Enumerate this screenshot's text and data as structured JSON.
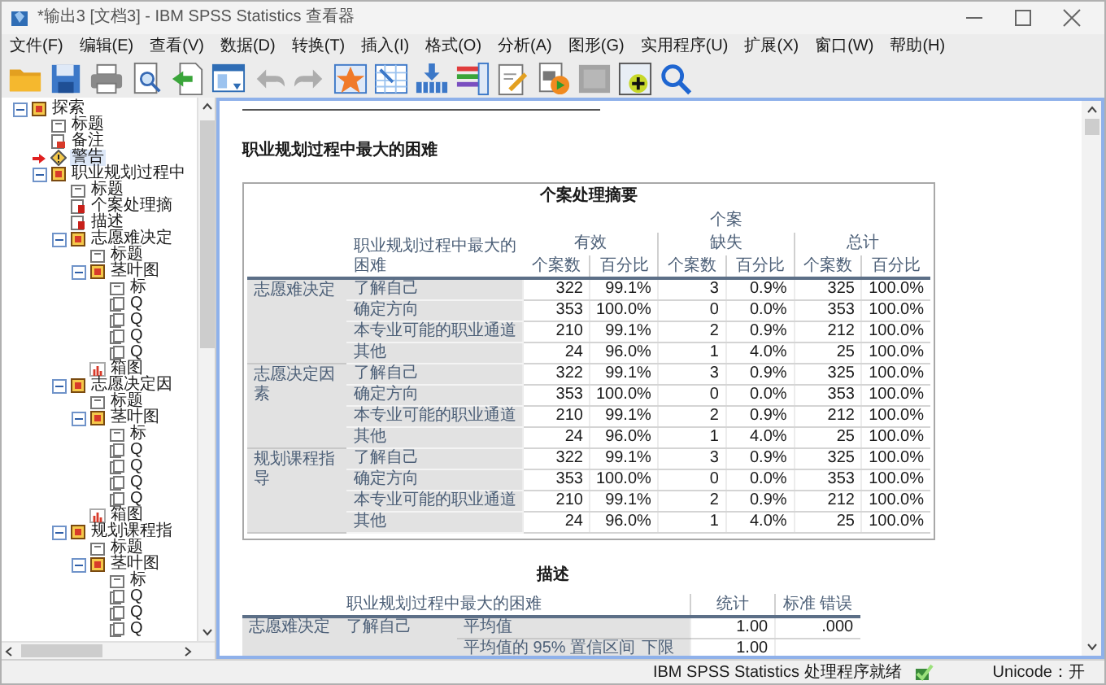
{
  "window": {
    "title": "*输出3 [文档3] - IBM SPSS Statistics 查看器"
  },
  "menu": [
    "文件(F)",
    "编辑(E)",
    "查看(V)",
    "数据(D)",
    "转换(T)",
    "插入(I)",
    "格式(O)",
    "分析(A)",
    "图形(G)",
    "实用程序(U)",
    "扩展(X)",
    "窗口(W)",
    "帮助(H)"
  ],
  "toolbar": [
    {
      "kind": "open",
      "disabled": false
    },
    {
      "kind": "save",
      "disabled": false
    },
    {
      "kind": "print",
      "disabled": false
    },
    {
      "kind": "preview",
      "disabled": false
    },
    {
      "kind": "export",
      "disabled": false
    },
    {
      "kind": "recall",
      "disabled": false
    },
    {
      "kind": "undo",
      "disabled": true
    },
    {
      "kind": "redo",
      "disabled": true
    },
    {
      "kind": "goto-data",
      "disabled": false
    },
    {
      "kind": "goto-case",
      "disabled": false
    },
    {
      "kind": "goto-variable",
      "disabled": false
    },
    {
      "kind": "variables",
      "disabled": false
    },
    {
      "kind": "designate",
      "disabled": false
    },
    {
      "kind": "run-script",
      "disabled": false
    },
    {
      "kind": "select-last",
      "disabled": true
    },
    {
      "kind": "insert-output",
      "disabled": false
    },
    {
      "kind": "search",
      "disabled": false
    }
  ],
  "outline": [
    {
      "label": "探索",
      "kind": "procedure",
      "expanded": true,
      "selected": false,
      "children": [
        {
          "label": "标题",
          "kind": "title",
          "selected": false
        },
        {
          "label": "备注",
          "kind": "note",
          "selected": false
        },
        {
          "label": "警告",
          "kind": "warning",
          "selected": true
        },
        {
          "label": "职业规划过程中",
          "kind": "procedure",
          "expanded": true,
          "selected": false,
          "children": [
            {
              "label": "标题",
              "kind": "title",
              "selected": false
            },
            {
              "label": "个案处理摘",
              "kind": "table",
              "selected": false
            },
            {
              "label": "描述",
              "kind": "table",
              "selected": false
            },
            {
              "label": "志愿难决定",
              "kind": "procedure",
              "expanded": true,
              "selected": false,
              "children": [
                {
                  "label": "标题",
                  "kind": "title",
                  "selected": false
                },
                {
                  "label": "茎叶图",
                  "kind": "procedure",
                  "expanded": true,
                  "selected": false,
                  "children": [
                    {
                      "label": "标",
                      "kind": "title",
                      "selected": false
                    },
                    {
                      "label": "Q",
                      "kind": "text",
                      "selected": false
                    },
                    {
                      "label": "Q",
                      "kind": "text",
                      "selected": false
                    },
                    {
                      "label": "Q",
                      "kind": "text",
                      "selected": false
                    },
                    {
                      "label": "Q",
                      "kind": "text",
                      "selected": false
                    }
                  ]
                },
                {
                  "label": "箱图",
                  "kind": "chart",
                  "selected": false
                }
              ]
            },
            {
              "label": "志愿决定因",
              "kind": "procedure",
              "expanded": true,
              "selected": false,
              "children": [
                {
                  "label": "标题",
                  "kind": "title",
                  "selected": false
                },
                {
                  "label": "茎叶图",
                  "kind": "procedure",
                  "expanded": true,
                  "selected": false,
                  "children": [
                    {
                      "label": "标",
                      "kind": "title",
                      "selected": false
                    },
                    {
                      "label": "Q",
                      "kind": "text",
                      "selected": false
                    },
                    {
                      "label": "Q",
                      "kind": "text",
                      "selected": false
                    },
                    {
                      "label": "Q",
                      "kind": "text",
                      "selected": false
                    },
                    {
                      "label": "Q",
                      "kind": "text",
                      "selected": false
                    }
                  ]
                },
                {
                  "label": "箱图",
                  "kind": "chart",
                  "selected": false
                }
              ]
            },
            {
              "label": "规划课程指",
              "kind": "procedure",
              "expanded": true,
              "selected": false,
              "children": [
                {
                  "label": "标题",
                  "kind": "title",
                  "selected": false
                },
                {
                  "label": "茎叶图",
                  "kind": "procedure",
                  "expanded": true,
                  "selected": false,
                  "children": [
                    {
                      "label": "标",
                      "kind": "title",
                      "selected": false
                    },
                    {
                      "label": "Q",
                      "kind": "text",
                      "selected": false
                    },
                    {
                      "label": "Q",
                      "kind": "text",
                      "selected": false
                    },
                    {
                      "label": "Q",
                      "kind": "text",
                      "selected": false
                    }
                  ]
                }
              ]
            }
          ]
        }
      ]
    }
  ],
  "output": {
    "heading": "职业规划过程中最大的困难",
    "case_summary": {
      "title": "个案处理摘要",
      "span_header": "个案",
      "row_header": "职业规划过程中最大的困难",
      "groups": [
        "有效",
        "缺失",
        "总计"
      ],
      "subheaders": [
        "个案数",
        "百分比",
        "个案数",
        "百分比",
        "个案数",
        "百分比"
      ],
      "row_groups": [
        {
          "label": "志愿难决定",
          "rows": [
            {
              "category": "了解自己",
              "cells": [
                "322",
                "99.1%",
                "3",
                "0.9%",
                "325",
                "100.0%"
              ]
            },
            {
              "category": "确定方向",
              "cells": [
                "353",
                "100.0%",
                "0",
                "0.0%",
                "353",
                "100.0%"
              ]
            },
            {
              "category": "本专业可能的职业通道",
              "cells": [
                "210",
                "99.1%",
                "2",
                "0.9%",
                "212",
                "100.0%"
              ]
            },
            {
              "category": "其他",
              "cells": [
                "24",
                "96.0%",
                "1",
                "4.0%",
                "25",
                "100.0%"
              ]
            }
          ]
        },
        {
          "label": "志愿决定因素",
          "rows": [
            {
              "category": "了解自己",
              "cells": [
                "322",
                "99.1%",
                "3",
                "0.9%",
                "325",
                "100.0%"
              ]
            },
            {
              "category": "确定方向",
              "cells": [
                "353",
                "100.0%",
                "0",
                "0.0%",
                "353",
                "100.0%"
              ]
            },
            {
              "category": "本专业可能的职业通道",
              "cells": [
                "210",
                "99.1%",
                "2",
                "0.9%",
                "212",
                "100.0%"
              ]
            },
            {
              "category": "其他",
              "cells": [
                "24",
                "96.0%",
                "1",
                "4.0%",
                "25",
                "100.0%"
              ]
            }
          ]
        },
        {
          "label": "规划课程指导",
          "rows": [
            {
              "category": "了解自己",
              "cells": [
                "322",
                "99.1%",
                "3",
                "0.9%",
                "325",
                "100.0%"
              ]
            },
            {
              "category": "确定方向",
              "cells": [
                "353",
                "100.0%",
                "0",
                "0.0%",
                "353",
                "100.0%"
              ]
            },
            {
              "category": "本专业可能的职业通道",
              "cells": [
                "210",
                "99.1%",
                "2",
                "0.9%",
                "212",
                "100.0%"
              ]
            },
            {
              "category": "其他",
              "cells": [
                "24",
                "96.0%",
                "1",
                "4.0%",
                "25",
                "100.0%"
              ]
            }
          ]
        }
      ]
    },
    "descriptives": {
      "title": "描述",
      "row_header": "职业规划过程中最大的困难",
      "columns": [
        "统计",
        "标准 错误"
      ],
      "rows": [
        {
          "group": "志愿难决定",
          "category": "了解自己",
          "statistic": "平均值",
          "cells": [
            "1.00",
            ".000"
          ]
        },
        {
          "statistic": "平均值的 95% 置信区间",
          "bound": "下限",
          "cells": [
            "1.00"
          ]
        }
      ]
    }
  },
  "status_bar": {
    "message": "IBM SPSS Statistics 处理程序就绪",
    "encoding": "Unicode：开"
  }
}
